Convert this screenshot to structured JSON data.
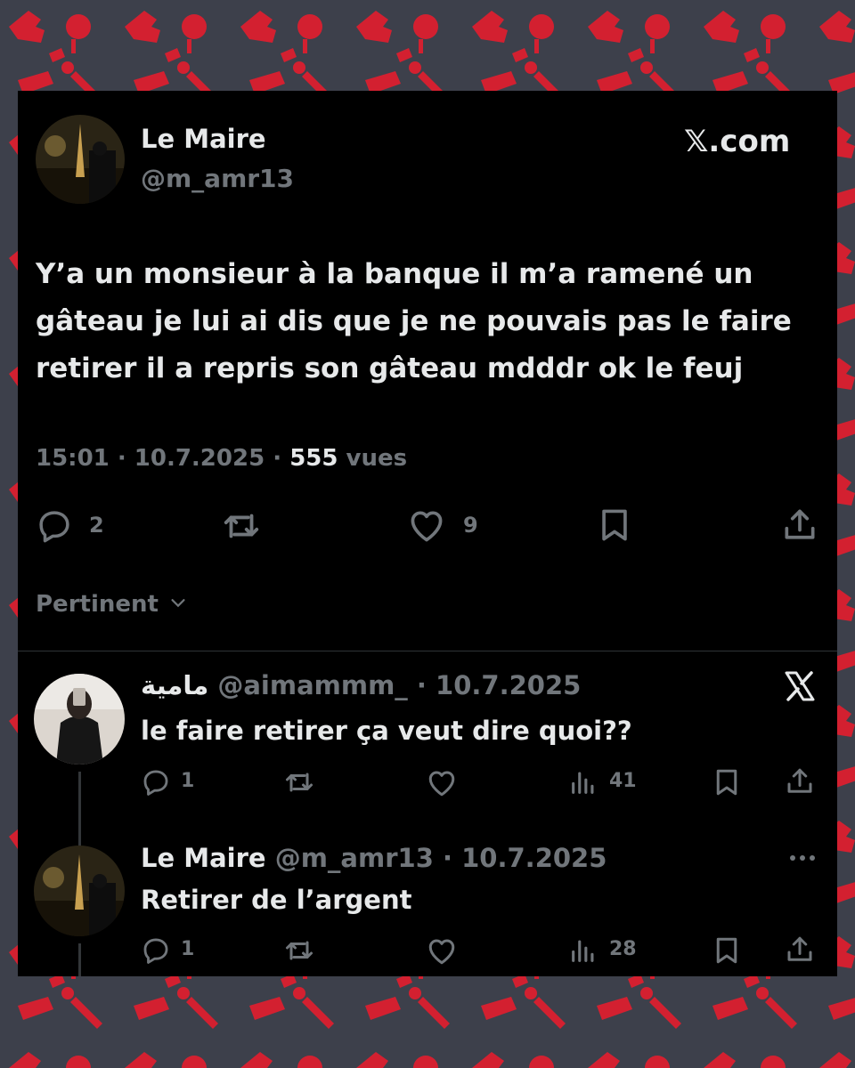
{
  "brand": {
    "label": "𝕏.com"
  },
  "main_tweet": {
    "author_name": "Le Maire",
    "handle": "@m_amr13",
    "text_lines": [
      "Y’a un monsieur à la banque il m’a ramené un",
      "gâteau je lui ai dis que je ne pouvais pas le faire",
      "retirer il a repris son gâteau mdddr ok le feuj"
    ],
    "time": "15:01",
    "date": "10.7.2025",
    "views_count": "555",
    "views_label": "vues",
    "separator": "·",
    "reply_count": "2",
    "like_count": "9"
  },
  "sort": {
    "label": "Pertinent"
  },
  "replies": [
    {
      "author_name": "مامية",
      "handle": "@aimammm_",
      "date": "10.7.2025",
      "separator": "·",
      "text": "le faire retirer ça veut dire quoi??",
      "reply_count": "1",
      "views": "41"
    },
    {
      "author_name": "Le Maire",
      "handle": "@m_amr13",
      "date": "10.7.2025",
      "separator": "·",
      "text": "Retirer de l’argent",
      "reply_count": "1",
      "views": "28"
    }
  ],
  "icons": [
    "reply-icon",
    "retweet-icon",
    "like-icon",
    "bookmark-icon",
    "share-icon",
    "views-icon",
    "x-logo-icon",
    "more-icon",
    "chevron-down-icon"
  ],
  "colors": {
    "card": "#000000",
    "text": "#e7e9ea",
    "muted": "#71767b",
    "pattern_bg": "#3d404b",
    "pattern_fg": "#d32030"
  }
}
